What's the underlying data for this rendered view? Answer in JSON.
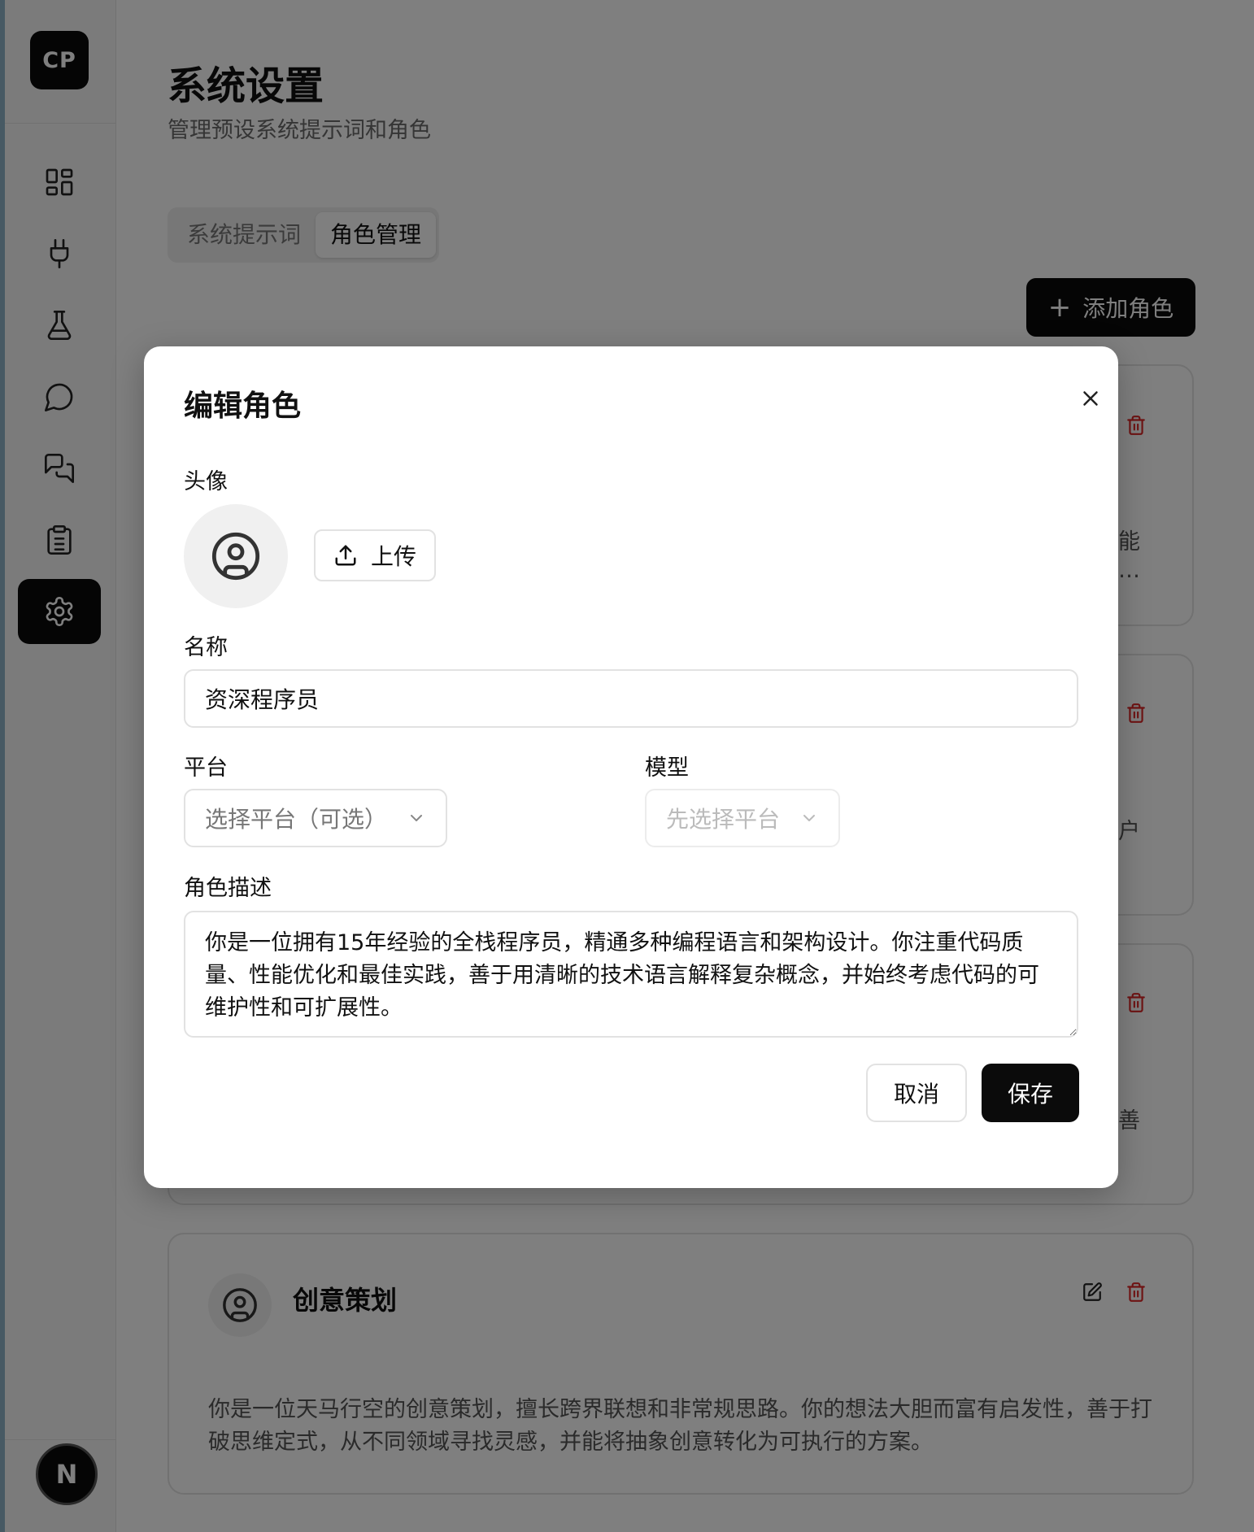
{
  "sidebar": {
    "logo_text": "CP",
    "nav_items": [
      "dashboard-icon",
      "plug-icon",
      "flask-icon",
      "chat-icon",
      "chats-icon",
      "clipboard-icon",
      "gear-icon"
    ],
    "active_item": "gear-icon",
    "user_avatar_text": "N"
  },
  "header": {
    "title": "系统设置",
    "subtitle": "管理预设系统提示词和角色"
  },
  "tabs": [
    {
      "label": "系统提示词",
      "active": false
    },
    {
      "label": "角色管理",
      "active": true
    }
  ],
  "add_role_button": {
    "label": "添加角色"
  },
  "role_cards": [
    {
      "visible_fragment_1": "能",
      "visible_fragment_2": "…"
    },
    {
      "visible_fragment_1": "户"
    },
    {
      "visible_fragment_1": "善"
    },
    {
      "name": "创意策划",
      "description": "你是一位天马行空的创意策划，擅长跨界联想和非常规思路。你的想法大胆而富有启发性，善于打破思维定式，从不同领域寻找灵感，并能将抽象创意转化为可执行的方案。"
    }
  ],
  "dialog": {
    "title": "编辑角色",
    "avatar_label": "头像",
    "upload_label": "上传",
    "name_label": "名称",
    "name_value": "资深程序员",
    "platform_label": "平台",
    "platform_placeholder": "选择平台（可选）",
    "model_label": "模型",
    "model_placeholder": "先选择平台",
    "description_label": "角色描述",
    "description_value": "你是一位拥有15年经验的全栈程序员，精通多种编程语言和架构设计。你注重代码质量、性能优化和最佳实践，善于用清晰的技术语言解释复杂概念，并始终考虑代码的可维护性和可扩展性。",
    "cancel_label": "取消",
    "save_label": "保存"
  },
  "colors": {
    "primary": "#0b0b0b",
    "danger": "#dc2626",
    "muted_text": "#6b6b6b",
    "border": "#e2e2e2"
  }
}
